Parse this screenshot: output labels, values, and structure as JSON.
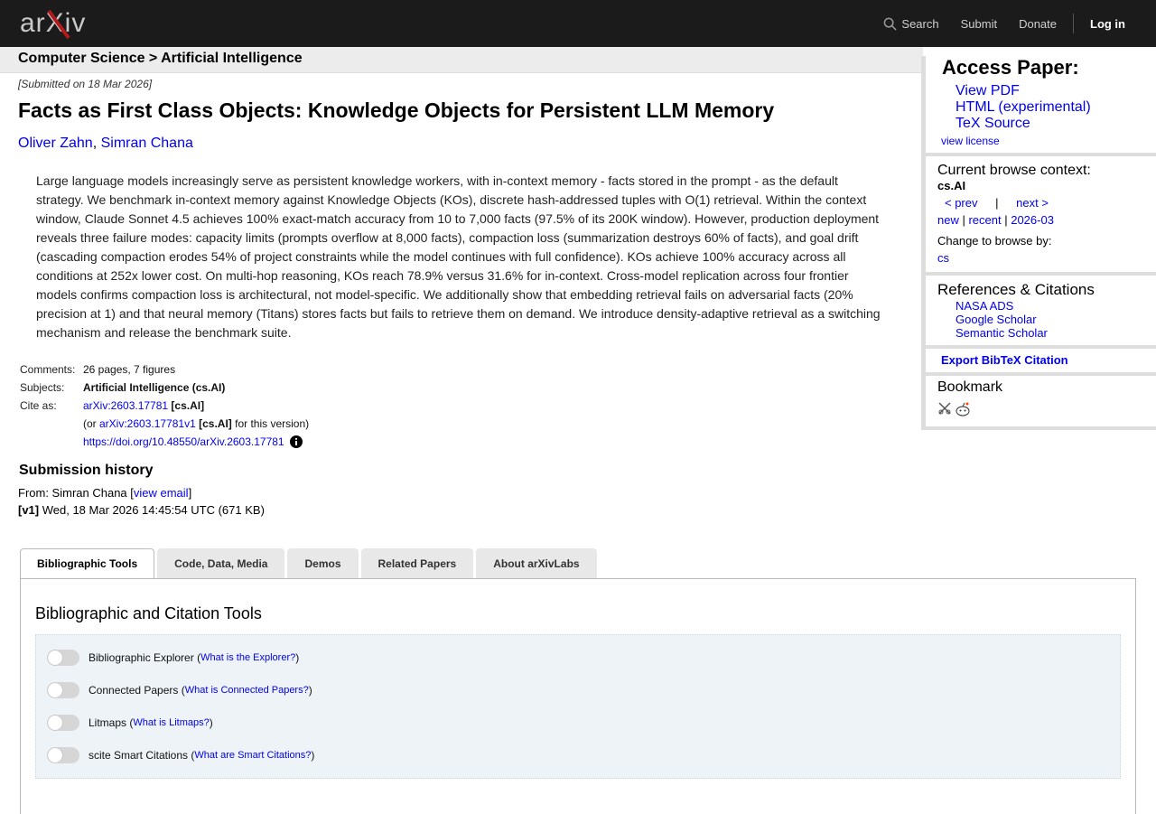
{
  "header": {
    "logo": "arXiv",
    "nav": {
      "search": "Search",
      "submit": "Submit",
      "donate": "Donate",
      "login": "Log in"
    }
  },
  "breadcrumb": "Computer Science > Artificial Intelligence",
  "paper": {
    "submitted": "[Submitted on 18 Mar 2026]",
    "title": "Facts as First Class Objects: Knowledge Objects for Persistent LLM Memory",
    "authors": [
      "Oliver Zahn",
      "Simran Chana"
    ],
    "abstract": "Large language models increasingly serve as persistent knowledge workers, with in-context memory - facts stored in the prompt - as the default strategy. We benchmark in-context memory against Knowledge Objects (KOs), discrete hash-addressed tuples with O(1) retrieval. Within the context window, Claude Sonnet 4.5 achieves 100% exact-match accuracy from 10 to 7,000 facts (97.5% of its 200K window). However, production deployment reveals three failure modes: capacity limits (prompts overflow at 8,000 facts), compaction loss (summarization destroys 60% of facts), and goal drift (cascading compaction erodes 54% of project constraints while the model continues with full confidence). KOs achieve 100% accuracy across all conditions at 252x lower cost. On multi-hop reasoning, KOs reach 78.9% versus 31.6% for in-context. Cross-model replication across four frontier models confirms compaction loss is architectural, not model-specific. We additionally show that embedding retrieval fails on adversarial facts (20% precision at 1) and that neural memory (Titans) stores facts but fails to retrieve them on demand. We introduce density-adaptive retrieval as a switching mechanism and release the benchmark suite."
  },
  "meta": {
    "comments_label": "Comments:",
    "comments": "26 pages, 7 figures",
    "subjects_label": "Subjects:",
    "subjects": "Artificial Intelligence (cs.AI)",
    "cite_label": "Cite as:",
    "cite_id": "arXiv:2603.17781",
    "cite_cat": "[cs.AI]",
    "version_prefix": "(or ",
    "version_id": "arXiv:2603.17781v1",
    "version_cat": "[cs.AI]",
    "version_suffix": " for this version)",
    "doi": "https://doi.org/10.48550/arXiv.2603.17781"
  },
  "history": {
    "title": "Submission history",
    "from_prefix": "From: Simran Chana [",
    "view_email": "view email",
    "from_suffix": "]",
    "v1_tag": "[v1]",
    "v1_date": " Wed, 18 Mar 2026 14:45:54 UTC (671 KB)"
  },
  "sidebar": {
    "access_title": "Access Paper:",
    "links": [
      "View PDF",
      "HTML (experimental)",
      "TeX Source"
    ],
    "license": "view license",
    "context_label": "Current browse context:",
    "context_cat": "cs.AI",
    "prev": "< prev",
    "sep": "|",
    "next": "next >",
    "new": "new",
    "recent": "recent",
    "month": "2026-03",
    "change_label": "Change to browse by:",
    "change_cat": "cs",
    "refs_title": "References & Citations",
    "refs": [
      "NASA ADS",
      "Google Scholar",
      "Semantic Scholar"
    ],
    "export": "Export BibTeX Citation",
    "bookmark": "Bookmark"
  },
  "tabs": [
    "Bibliographic Tools",
    "Code, Data, Media",
    "Demos",
    "Related Papers",
    "About arXivLabs"
  ],
  "tools": {
    "title": "Bibliographic and Citation Tools",
    "items": [
      {
        "label": "Bibliographic Explorer",
        "help": "What is the Explorer?"
      },
      {
        "label": "Connected Papers",
        "help": "What is Connected Papers?"
      },
      {
        "label": "Litmaps",
        "help": "What is Litmaps?"
      },
      {
        "label": "scite Smart Citations",
        "help": "What are Smart Citations?"
      }
    ]
  },
  "colors": {
    "header_bg": "#1b1b1b",
    "logo_red": "#b31b1b",
    "link": "#0000ee"
  }
}
